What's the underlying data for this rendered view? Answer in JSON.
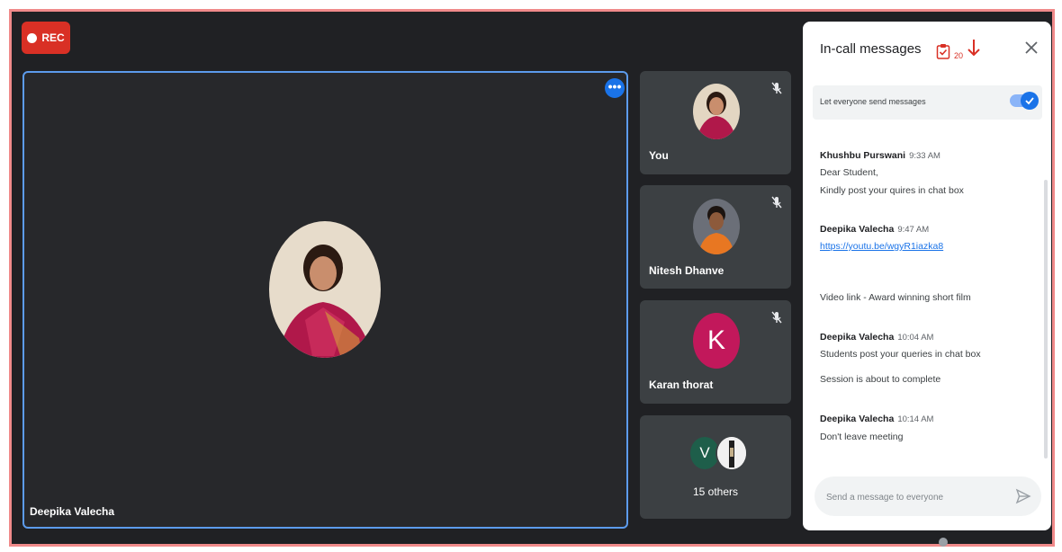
{
  "recording": {
    "label": "REC"
  },
  "main_video": {
    "participant_name": "Deepika Valecha",
    "more_icon": "more-options-icon"
  },
  "side_tiles": [
    {
      "name": "You",
      "muted": true
    },
    {
      "name": "Nitesh Dhanve",
      "muted": true
    },
    {
      "name": "Karan thorat",
      "initial": "K",
      "muted": true
    }
  ],
  "others": {
    "initial": "V",
    "label": "15 others"
  },
  "chat_panel": {
    "title": "In-call messages",
    "count": "20",
    "toggle_label": "Let everyone send messages",
    "toggle_on": true,
    "messages": [
      {
        "sender": "Khushbu Purswani",
        "time": "9:33 AM",
        "lines": [
          "Dear Student,",
          "Kindly post your quires in chat box"
        ]
      },
      {
        "sender": "Deepika Valecha",
        "time": "9:47 AM",
        "link": "https://youtu.be/wgyR1iazka8",
        "lines": [
          "Video link - Award winning short film"
        ]
      },
      {
        "sender": "Deepika Valecha",
        "time": "10:04 AM",
        "lines": [
          "Students post your queries in chat box",
          "Session is about to complete"
        ]
      },
      {
        "sender": "Deepika Valecha",
        "time": "10:14 AM",
        "lines": [
          "Don't leave meeting"
        ]
      }
    ],
    "compose_placeholder": "Send a message to everyone"
  },
  "colors": {
    "accent": "#1a73e8",
    "rec": "#d93025",
    "frame_border": "#f08a8a",
    "background": "#202124"
  }
}
